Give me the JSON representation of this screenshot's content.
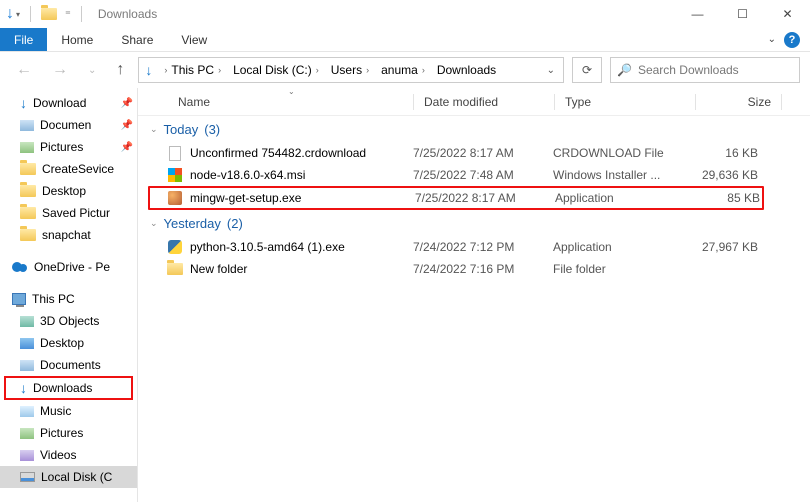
{
  "window": {
    "title": "Downloads"
  },
  "ribbon": {
    "file": "File",
    "tabs": [
      "Home",
      "Share",
      "View"
    ]
  },
  "breadcrumb": [
    "This PC",
    "Local Disk (C:)",
    "Users",
    "anuma",
    "Downloads"
  ],
  "search": {
    "placeholder": "Search Downloads"
  },
  "columns": {
    "name": "Name",
    "date": "Date modified",
    "type": "Type",
    "size": "Size"
  },
  "sidebar": {
    "quick": [
      {
        "label": "Download",
        "icon": "dl",
        "pin": true
      },
      {
        "label": "Documen",
        "icon": "doc",
        "pin": true
      },
      {
        "label": "Pictures",
        "icon": "pic",
        "pin": true
      },
      {
        "label": "CreateSevice",
        "icon": "folder"
      },
      {
        "label": "Desktop",
        "icon": "folder"
      },
      {
        "label": "Saved Pictur",
        "icon": "folder"
      },
      {
        "label": "snapchat",
        "icon": "folder"
      }
    ],
    "onedrive": "OneDrive - Pe",
    "thispc": "This PC",
    "pcitems": [
      {
        "label": "3D Objects",
        "icon": "obj3d"
      },
      {
        "label": "Desktop",
        "icon": "desk"
      },
      {
        "label": "Documents",
        "icon": "doc"
      },
      {
        "label": "Downloads",
        "icon": "dl",
        "highlight": true
      },
      {
        "label": "Music",
        "icon": "music"
      },
      {
        "label": "Pictures",
        "icon": "pic"
      },
      {
        "label": "Videos",
        "icon": "vid"
      },
      {
        "label": "Local Disk (C",
        "icon": "disk",
        "selected": true
      }
    ]
  },
  "groups": [
    {
      "label": "Today",
      "count": "(3)",
      "rows": [
        {
          "name": "Unconfirmed 754482.crdownload",
          "date": "7/25/2022 8:17 AM",
          "type": "CRDOWNLOAD File",
          "size": "16 KB",
          "icon": "blank"
        },
        {
          "name": "node-v18.6.0-x64.msi",
          "date": "7/25/2022 7:48 AM",
          "type": "Windows Installer ...",
          "size": "29,636 KB",
          "icon": "msi"
        },
        {
          "name": "mingw-get-setup.exe",
          "date": "7/25/2022 8:17 AM",
          "type": "Application",
          "size": "85 KB",
          "icon": "exe",
          "highlight": true
        }
      ]
    },
    {
      "label": "Yesterday",
      "count": "(2)",
      "rows": [
        {
          "name": "python-3.10.5-amd64 (1).exe",
          "date": "7/24/2022 7:12 PM",
          "type": "Application",
          "size": "27,967 KB",
          "icon": "py"
        },
        {
          "name": "New folder",
          "date": "7/24/2022 7:16 PM",
          "type": "File folder",
          "size": "",
          "icon": "folder"
        }
      ]
    }
  ]
}
